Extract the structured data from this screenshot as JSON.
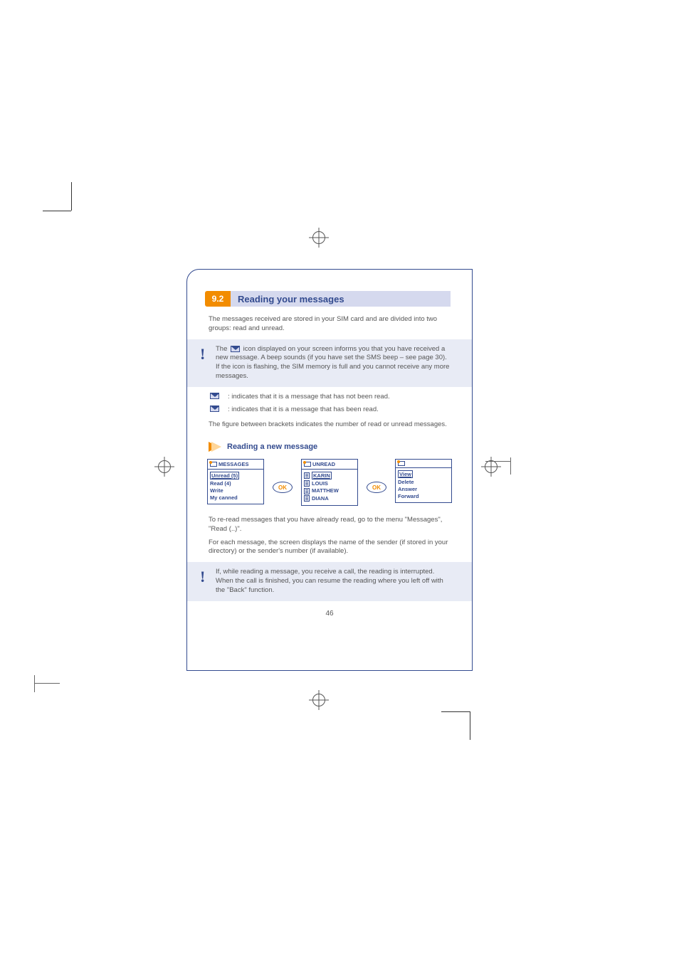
{
  "section": {
    "num": "9.2",
    "title": "Reading your messages"
  },
  "intro": "The messages received are stored in your SIM card and are divided into two groups: read and unread.",
  "note1_prefix": "The ",
  "note1_icon_label": "envelope",
  "note1_rest": " icon displayed on your screen informs you that you have received a new message. A beep sounds (if you have set the SMS beep – see page 30). If the icon is flashing, the SIM memory is full and you cannot receive any more messages.",
  "icon_lines": [
    ": indicates that it is a message that has not been read.",
    ": indicates that it is a message that has been read."
  ],
  "body_after_icons": "The figure between brackets indicates the number of read or unread messages.",
  "subhead": "Reading a new message",
  "screens": {
    "s1": {
      "title": "MESSAGES",
      "items": [
        "Unread (5)",
        "Read (4)",
        "Write",
        "My canned"
      ]
    },
    "ok": "OK",
    "s2": {
      "title": "UNREAD",
      "items": [
        "KARIN",
        "LOUIS",
        "MATTHEW",
        "DIANA"
      ]
    },
    "s3": {
      "items": [
        "View",
        "Delete",
        "Answer",
        "Forward"
      ]
    }
  },
  "foot1": "To re-read messages that you have already read, go to the menu \"Messages\", \"Read (..)\".",
  "foot2": "For each message, the screen displays the name of the sender (if stored in your directory) or the sender's number (if available).",
  "note2": "If, while reading a message, you receive a call, the reading is interrupted. When the call is finished, you can resume the reading where you left off with the \"Back\" function.",
  "page_num": "46"
}
